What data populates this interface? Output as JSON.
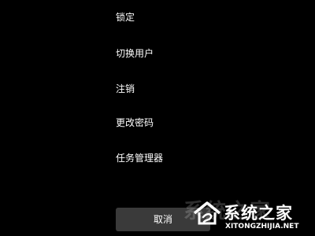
{
  "menu": {
    "items": [
      {
        "label": "锁定"
      },
      {
        "label": "切换用户"
      },
      {
        "label": "注销"
      },
      {
        "label": "更改密码"
      },
      {
        "label": "任务管理器"
      }
    ]
  },
  "cancel_button": {
    "label": "取消"
  },
  "watermark": {
    "ghost_text": "系统之家",
    "site_name": "系统之家",
    "url": "XITONGZHIJIA.NET",
    "logo_icon": "house-logo-icon"
  },
  "colors": {
    "background": "#000000",
    "text": "#ffffff",
    "button_background": "#3a3a3a"
  }
}
